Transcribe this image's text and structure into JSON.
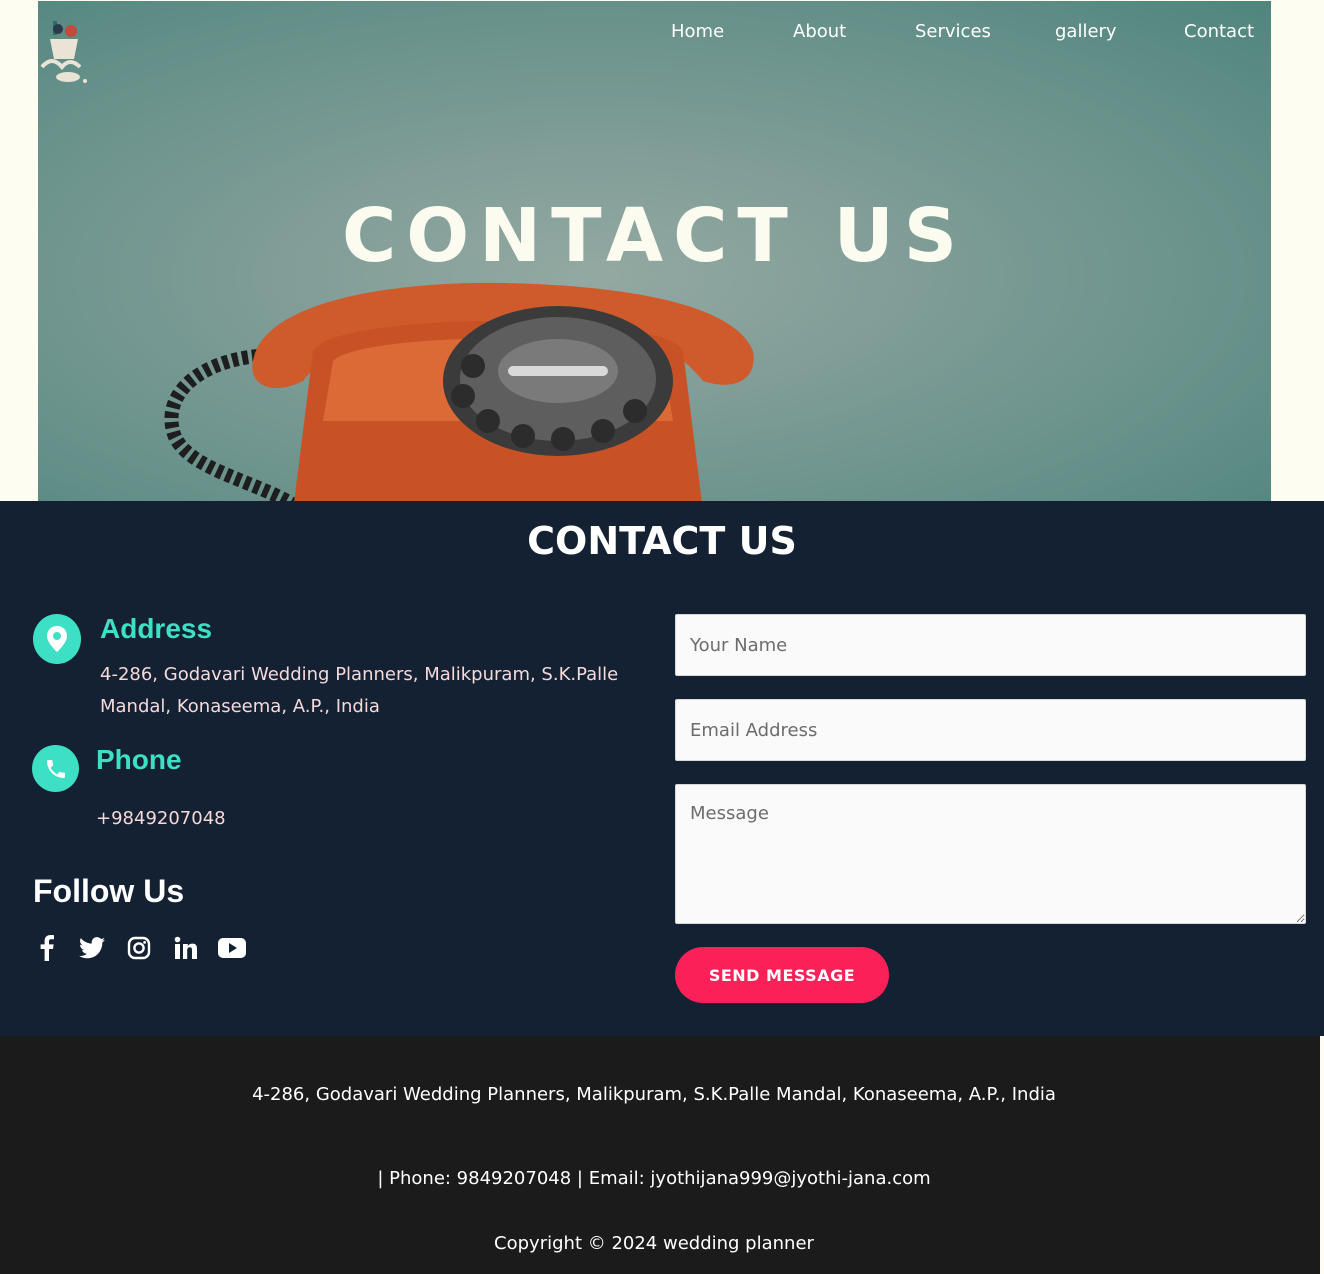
{
  "nav": {
    "items": [
      "Home",
      "About",
      "Services",
      "gallery",
      "Contact"
    ]
  },
  "hero": {
    "title": "CONTACT US"
  },
  "contact": {
    "heading": "CONTACT US",
    "address_title": "Address",
    "address_text": "4-286, Godavari Wedding Planners, Malikpuram, S.K.Palle Mandal, Konaseema, A.P., India",
    "phone_title": "Phone",
    "phone_text": "+9849207048",
    "follow_title": "Follow Us",
    "social_icons": [
      "facebook-icon",
      "twitter-icon",
      "instagram-icon",
      "linkedin-icon",
      "youtube-icon"
    ],
    "form": {
      "name_placeholder": "Your Name",
      "email_placeholder": "Email Address",
      "message_placeholder": "Message",
      "send_label": "SEND MESSAGE"
    }
  },
  "footer": {
    "address": "4-286, Godavari Wedding Planners, Malikpuram, S.K.Palle Mandal, Konaseema, A.P., India",
    "contact_line": "| Phone: 9849207048 | Email: jyothijana999@jyothi-jana.com",
    "copyright": "Copyright © 2024 wedding planner"
  },
  "colors": {
    "accent": "#3ee0c5",
    "button": "#fc2059",
    "section_bg": "#132133",
    "footer_bg": "#1b1b1b"
  }
}
